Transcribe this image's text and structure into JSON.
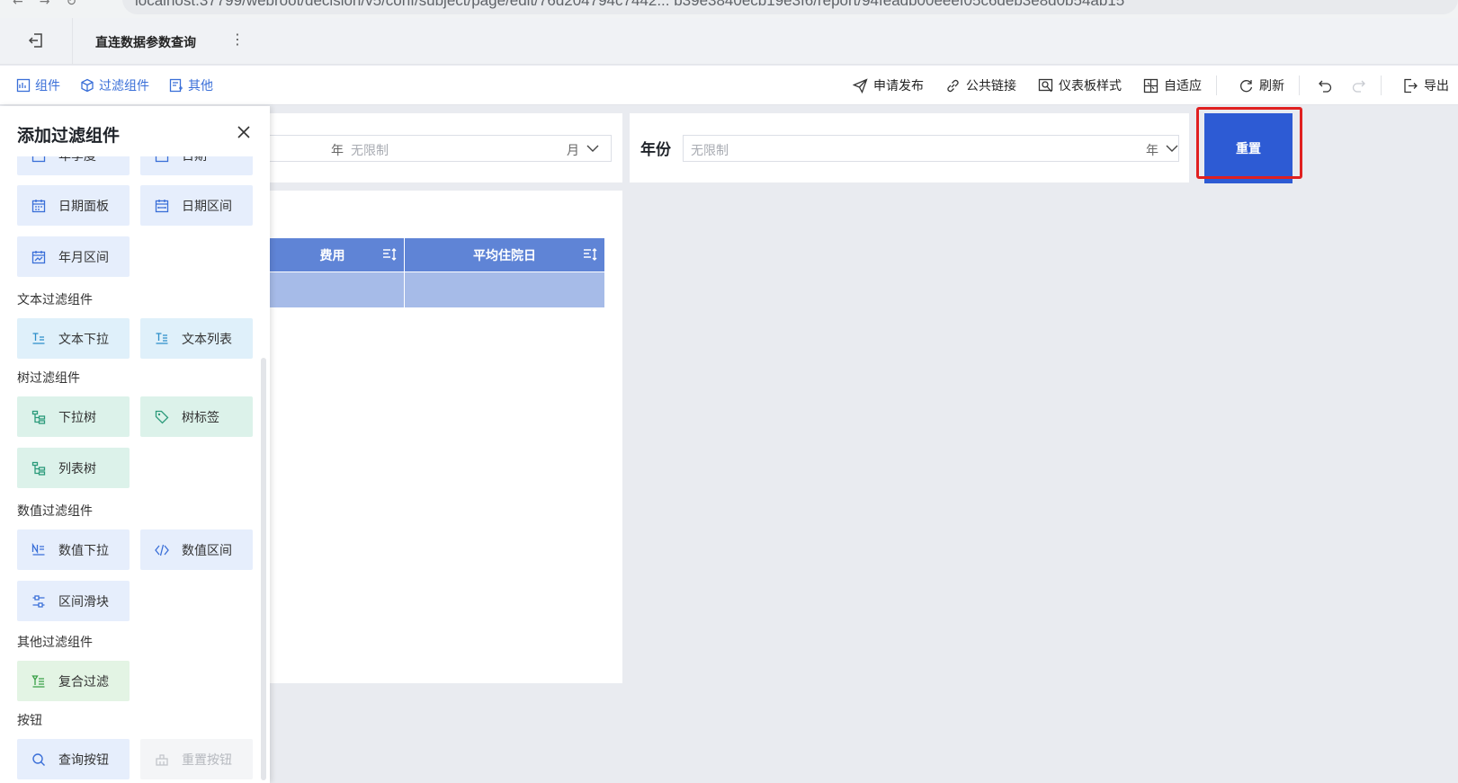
{
  "browser": {
    "url": "localhost:37799/webroot/decision/v5/conf/subject/page/edit/76d204794c7442... b39e3840ecb19e3f6/report/94feadb00eeef05c6deb3e8d0b54ab15"
  },
  "header": {
    "title": "直连数据参数查询"
  },
  "toolbar": {
    "left": [
      {
        "label": "组件",
        "icon": "widget-icon"
      },
      {
        "label": "过滤组件",
        "icon": "filter-cube-icon"
      },
      {
        "label": "其他",
        "icon": "other-icon"
      }
    ],
    "right": {
      "publish": "申请发布",
      "public_link": "公共链接",
      "dashboard_style": "仪表板样式",
      "adaptive": "自适应",
      "refresh": "刷新",
      "export": "导出"
    }
  },
  "panel": {
    "title": "添加过滤组件",
    "date_chips": [
      "年季度",
      "日期",
      "日期面板",
      "日期区间",
      "年月区间"
    ],
    "sections": {
      "text": "文本过滤组件",
      "tree": "树过滤组件",
      "number": "数值过滤组件",
      "other": "其他过滤组件",
      "buttons": "按钮"
    },
    "text_chips": [
      "文本下拉",
      "文本列表"
    ],
    "tree_chips": [
      "下拉树",
      "树标签",
      "列表树"
    ],
    "number_chips": [
      "数值下拉",
      "数值区间",
      "区间滑块"
    ],
    "other_chips": [
      "复合过滤"
    ],
    "button_chips": [
      "查询按钮",
      "重置按钮"
    ]
  },
  "canvas": {
    "widget1": {
      "unit_year": "年",
      "placeholder": "无限制",
      "unit_month": "月"
    },
    "widget2": {
      "label": "年份",
      "placeholder": "无限制",
      "unit": "年"
    },
    "reset_button": "重置",
    "table": {
      "columns": [
        "费用",
        "平均住院日"
      ]
    }
  },
  "colors": {
    "accent": "#2d5bd4",
    "table_header": "#5f84d6",
    "table_row": "#a6bbe8",
    "highlight": "#e02020"
  }
}
